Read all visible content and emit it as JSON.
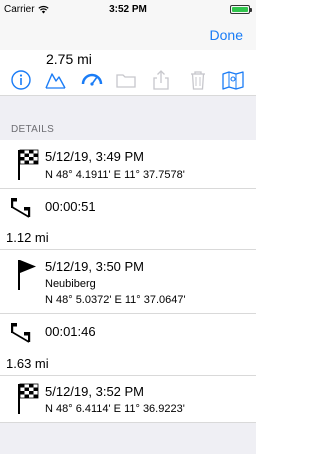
{
  "status_bar": {
    "carrier": "Carrier",
    "time": "3:52 PM"
  },
  "nav": {
    "done_label": "Done"
  },
  "summary": {
    "distance": "2.75 mi"
  },
  "toolbar": [
    "info-icon",
    "elevation-profile-icon",
    "speedometer-icon",
    "folder-icon",
    "share-icon",
    "trash-icon",
    "map-icon"
  ],
  "details": {
    "section_title": "DETAILS",
    "rows": [
      {
        "type": "waypoint",
        "icon": "checkered-flag-icon",
        "datetime": "5/12/19, 3:49 PM",
        "coords": "N 48° 4.1911' E 11° 37.7578'"
      },
      {
        "type": "segment",
        "icon": "segment-icon",
        "duration": "00:00:51",
        "distance": "1.12 mi"
      },
      {
        "type": "waypoint",
        "icon": "flag-icon",
        "datetime": "5/12/19, 3:50 PM",
        "place": "Neubiberg",
        "coords": "N 48° 5.0372' E 11° 37.0647'"
      },
      {
        "type": "segment",
        "icon": "segment-icon",
        "duration": "00:01:46",
        "distance": "1.63 mi"
      },
      {
        "type": "waypoint",
        "icon": "checkered-flag-icon",
        "datetime": "5/12/19, 3:52 PM",
        "coords": "N 48° 6.4114' E 11° 36.9223'"
      }
    ]
  },
  "colors": {
    "accent": "#1a7cf6",
    "disabled": "#c7c7cc",
    "section_bg": "#efeff4"
  }
}
